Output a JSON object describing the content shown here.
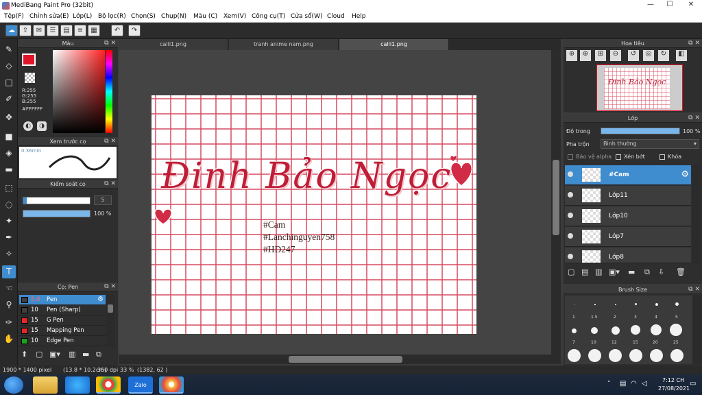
{
  "window": {
    "title": "MediBang Paint Pro (32bit)",
    "minimize": "—",
    "maximize": "☐",
    "close": "✕"
  },
  "menu": [
    "Tệp(F)",
    "Chỉnh sửa(E)",
    "Lớp(L)",
    "Bộ lọc(R)",
    "Chọn(S)",
    "Chụp(N)",
    "Màu (C)",
    "Xem(V)",
    "Công cụ(T)",
    "Cửa sổ(W)",
    "Cloud",
    "Help"
  ],
  "tabs": [
    "calli1.png",
    "tranh anime nam.png",
    "calli1.png"
  ],
  "color_panel": {
    "title": "Màu",
    "r": "R:255",
    "g": "G:255",
    "b": "B:255",
    "hex": "#FFFFFF",
    "primary": "#e0152a"
  },
  "brush_preview": {
    "title": "Xem trước cọ",
    "size": "0.36mm"
  },
  "brush_control": {
    "title": "Kiểm soát cọ",
    "size": "5",
    "opacity": "100 %"
  },
  "brush_list": {
    "title": "Cọ: Pen",
    "items": [
      {
        "size": "5.0",
        "name": "Pen",
        "color": "#3f3f3f"
      },
      {
        "size": "10",
        "name": "Pen (Sharp)",
        "color": "#3f3f3f"
      },
      {
        "size": "15",
        "name": "G Pen",
        "color": "#e02828"
      },
      {
        "size": "15",
        "name": "Mapping Pen",
        "color": "#e02828"
      },
      {
        "size": "10",
        "name": "Edge Pen",
        "color": "#20a020"
      }
    ]
  },
  "canvas": {
    "calligraphy": "Đinh Bảo Ngọc",
    "hashtags": [
      "#Cam",
      "#Lanchinguyen758",
      "#HD247"
    ]
  },
  "navigator": {
    "title": "Hoa tiêu",
    "thumb_text": "Đinh Bảo Ngọc"
  },
  "layer_panel": {
    "title": "Lớp",
    "opacity_label": "Độ trong",
    "opacity_value": "100 %",
    "blend_label": "Pha trộn",
    "blend_value": "Bình thường",
    "protect_alpha": "Bảo vệ alpha",
    "clipping": "Xén bớt",
    "lock": "Khóa",
    "layers": [
      "#Cam",
      "Lớp11",
      "Lớp10",
      "Lớp7",
      "Lớp8"
    ]
  },
  "brush_size": {
    "title": "Brush Size",
    "labels": [
      "1",
      "1.5",
      "2",
      "3",
      "4",
      "5",
      "7",
      "10",
      "12",
      "15",
      "20",
      "25"
    ]
  },
  "status": {
    "dimensions": "1900 * 1400 pixel",
    "physical": "(13.8 * 10.2cm)",
    "dpi": "350 dpi",
    "zoom": "33 %",
    "cursor": "(1382, 62 )"
  },
  "taskbar": {
    "time": "7:12 CH",
    "date": "27/08/2021",
    "zalo": "Zalo"
  }
}
